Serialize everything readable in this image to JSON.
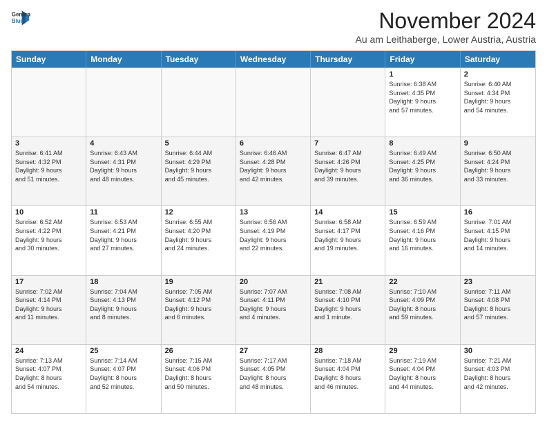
{
  "logo": {
    "line1": "General",
    "line2": "Blue"
  },
  "title": "November 2024",
  "subtitle": "Au am Leithaberge, Lower Austria, Austria",
  "header_days": [
    "Sunday",
    "Monday",
    "Tuesday",
    "Wednesday",
    "Thursday",
    "Friday",
    "Saturday"
  ],
  "weeks": [
    [
      {
        "day": "",
        "info": "",
        "empty": true
      },
      {
        "day": "",
        "info": "",
        "empty": true
      },
      {
        "day": "",
        "info": "",
        "empty": true
      },
      {
        "day": "",
        "info": "",
        "empty": true
      },
      {
        "day": "",
        "info": "",
        "empty": true
      },
      {
        "day": "1",
        "info": "Sunrise: 6:38 AM\nSunset: 4:35 PM\nDaylight: 9 hours\nand 57 minutes.",
        "empty": false
      },
      {
        "day": "2",
        "info": "Sunrise: 6:40 AM\nSunset: 4:34 PM\nDaylight: 9 hours\nand 54 minutes.",
        "empty": false
      }
    ],
    [
      {
        "day": "3",
        "info": "Sunrise: 6:41 AM\nSunset: 4:32 PM\nDaylight: 9 hours\nand 51 minutes.",
        "empty": false
      },
      {
        "day": "4",
        "info": "Sunrise: 6:43 AM\nSunset: 4:31 PM\nDaylight: 9 hours\nand 48 minutes.",
        "empty": false
      },
      {
        "day": "5",
        "info": "Sunrise: 6:44 AM\nSunset: 4:29 PM\nDaylight: 9 hours\nand 45 minutes.",
        "empty": false
      },
      {
        "day": "6",
        "info": "Sunrise: 6:46 AM\nSunset: 4:28 PM\nDaylight: 9 hours\nand 42 minutes.",
        "empty": false
      },
      {
        "day": "7",
        "info": "Sunrise: 6:47 AM\nSunset: 4:26 PM\nDaylight: 9 hours\nand 39 minutes.",
        "empty": false
      },
      {
        "day": "8",
        "info": "Sunrise: 6:49 AM\nSunset: 4:25 PM\nDaylight: 9 hours\nand 36 minutes.",
        "empty": false
      },
      {
        "day": "9",
        "info": "Sunrise: 6:50 AM\nSunset: 4:24 PM\nDaylight: 9 hours\nand 33 minutes.",
        "empty": false
      }
    ],
    [
      {
        "day": "10",
        "info": "Sunrise: 6:52 AM\nSunset: 4:22 PM\nDaylight: 9 hours\nand 30 minutes.",
        "empty": false
      },
      {
        "day": "11",
        "info": "Sunrise: 6:53 AM\nSunset: 4:21 PM\nDaylight: 9 hours\nand 27 minutes.",
        "empty": false
      },
      {
        "day": "12",
        "info": "Sunrise: 6:55 AM\nSunset: 4:20 PM\nDaylight: 9 hours\nand 24 minutes.",
        "empty": false
      },
      {
        "day": "13",
        "info": "Sunrise: 6:56 AM\nSunset: 4:19 PM\nDaylight: 9 hours\nand 22 minutes.",
        "empty": false
      },
      {
        "day": "14",
        "info": "Sunrise: 6:58 AM\nSunset: 4:17 PM\nDaylight: 9 hours\nand 19 minutes.",
        "empty": false
      },
      {
        "day": "15",
        "info": "Sunrise: 6:59 AM\nSunset: 4:16 PM\nDaylight: 9 hours\nand 16 minutes.",
        "empty": false
      },
      {
        "day": "16",
        "info": "Sunrise: 7:01 AM\nSunset: 4:15 PM\nDaylight: 9 hours\nand 14 minutes.",
        "empty": false
      }
    ],
    [
      {
        "day": "17",
        "info": "Sunrise: 7:02 AM\nSunset: 4:14 PM\nDaylight: 9 hours\nand 11 minutes.",
        "empty": false
      },
      {
        "day": "18",
        "info": "Sunrise: 7:04 AM\nSunset: 4:13 PM\nDaylight: 9 hours\nand 8 minutes.",
        "empty": false
      },
      {
        "day": "19",
        "info": "Sunrise: 7:05 AM\nSunset: 4:12 PM\nDaylight: 9 hours\nand 6 minutes.",
        "empty": false
      },
      {
        "day": "20",
        "info": "Sunrise: 7:07 AM\nSunset: 4:11 PM\nDaylight: 9 hours\nand 4 minutes.",
        "empty": false
      },
      {
        "day": "21",
        "info": "Sunrise: 7:08 AM\nSunset: 4:10 PM\nDaylight: 9 hours\nand 1 minute.",
        "empty": false
      },
      {
        "day": "22",
        "info": "Sunrise: 7:10 AM\nSunset: 4:09 PM\nDaylight: 8 hours\nand 59 minutes.",
        "empty": false
      },
      {
        "day": "23",
        "info": "Sunrise: 7:11 AM\nSunset: 4:08 PM\nDaylight: 8 hours\nand 57 minutes.",
        "empty": false
      }
    ],
    [
      {
        "day": "24",
        "info": "Sunrise: 7:13 AM\nSunset: 4:07 PM\nDaylight: 8 hours\nand 54 minutes.",
        "empty": false
      },
      {
        "day": "25",
        "info": "Sunrise: 7:14 AM\nSunset: 4:07 PM\nDaylight: 8 hours\nand 52 minutes.",
        "empty": false
      },
      {
        "day": "26",
        "info": "Sunrise: 7:15 AM\nSunset: 4:06 PM\nDaylight: 8 hours\nand 50 minutes.",
        "empty": false
      },
      {
        "day": "27",
        "info": "Sunrise: 7:17 AM\nSunset: 4:05 PM\nDaylight: 8 hours\nand 48 minutes.",
        "empty": false
      },
      {
        "day": "28",
        "info": "Sunrise: 7:18 AM\nSunset: 4:04 PM\nDaylight: 8 hours\nand 46 minutes.",
        "empty": false
      },
      {
        "day": "29",
        "info": "Sunrise: 7:19 AM\nSunset: 4:04 PM\nDaylight: 8 hours\nand 44 minutes.",
        "empty": false
      },
      {
        "day": "30",
        "info": "Sunrise: 7:21 AM\nSunset: 4:03 PM\nDaylight: 8 hours\nand 42 minutes.",
        "empty": false
      }
    ]
  ]
}
